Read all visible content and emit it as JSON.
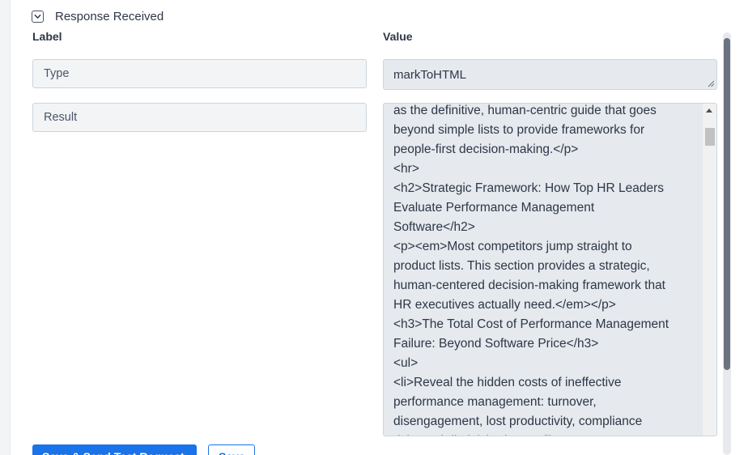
{
  "section": {
    "title": "Response Received"
  },
  "columns": {
    "label": "Label",
    "value": "Value"
  },
  "rows": [
    {
      "label": "Type",
      "value": "markToHTML"
    },
    {
      "label": "Result",
      "value": "as the definitive, human-centric guide that goes\nbeyond simple lists to provide frameworks for\npeople-first decision-making.</p>\n<hr>\n<h2>Strategic Framework: How Top HR Leaders\nEvaluate Performance Management\nSoftware</h2>\n<p><em>Most competitors jump straight to\nproduct lists. This section provides a strategic,\nhuman-centered decision-making framework that\nHR executives actually need.</em></p>\n<h3>The Total Cost of Performance Management\nFailure: Beyond Software Price</h3>\n<ul>\n<li>Reveal the hidden costs of ineffective\nperformance management: turnover,\ndisengagement, lost productivity, compliance\nrisks and diminished trust</li>"
    }
  ],
  "buttons": {
    "primary": "Save & Send Test Request",
    "secondary": "Save"
  },
  "colors": {
    "primary": "#1a73e8",
    "field_bg": "#f3f4f6",
    "value_bg": "#e6e9ed"
  }
}
